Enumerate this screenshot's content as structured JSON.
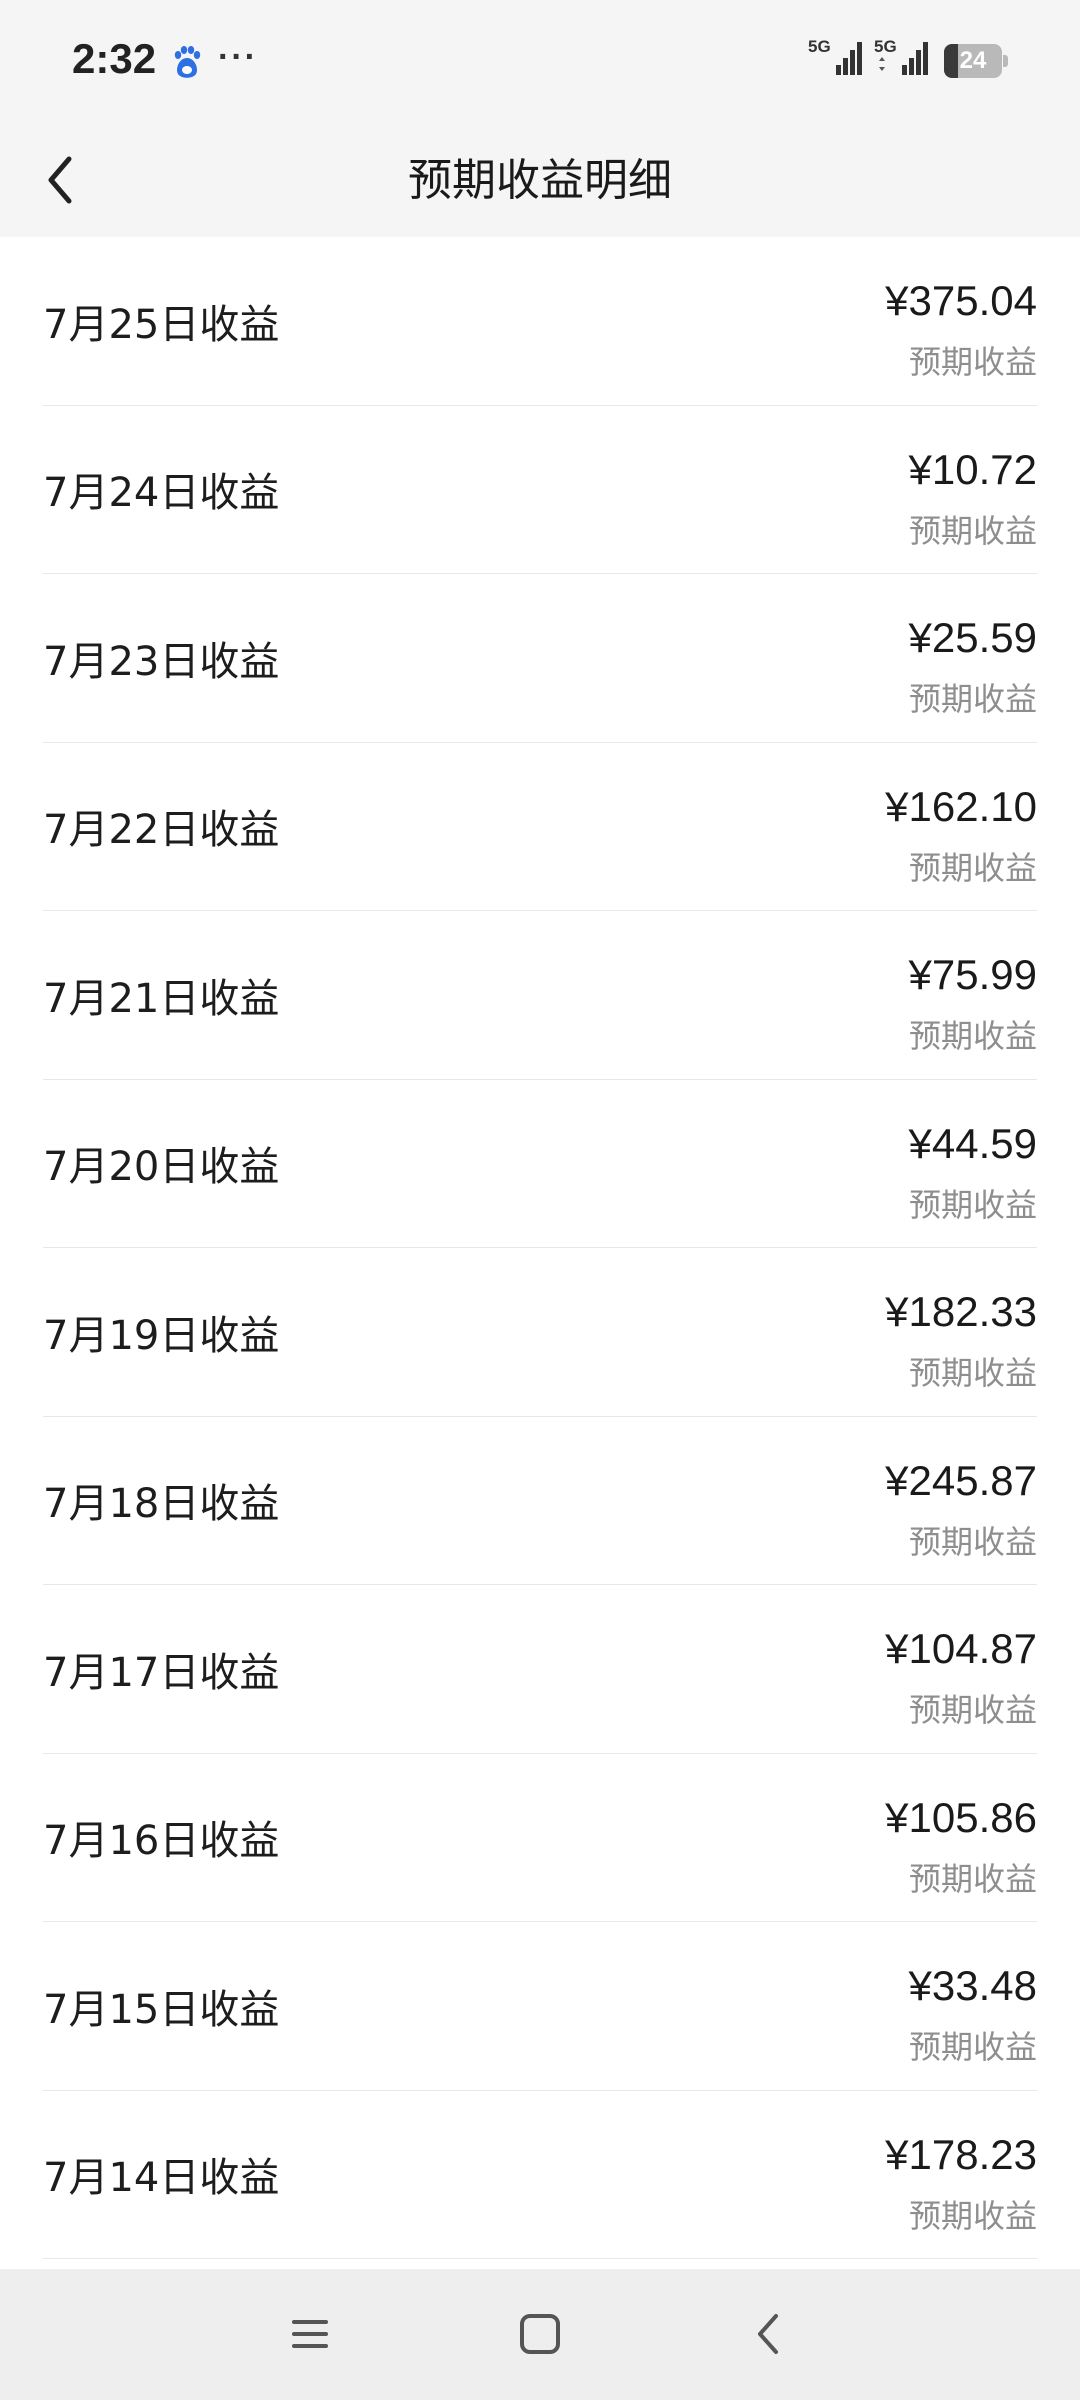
{
  "status_bar": {
    "time": "2:32",
    "icons": [
      "baidu-paw-icon",
      "more-dots-icon",
      "signal-5g-icon",
      "signal-5g-icon"
    ],
    "more": "···",
    "sim1_label": "5G",
    "sim2_label": "5G",
    "battery_text": "24",
    "battery_level": 0.24
  },
  "header": {
    "back_icon": "chevron-left-icon",
    "title": "预期收益明细"
  },
  "rows": [
    {
      "label": "7月25日收益",
      "amount": "¥375.04",
      "sub": "预期收益"
    },
    {
      "label": "7月24日收益",
      "amount": "¥10.72",
      "sub": "预期收益"
    },
    {
      "label": "7月23日收益",
      "amount": "¥25.59",
      "sub": "预期收益"
    },
    {
      "label": "7月22日收益",
      "amount": "¥162.10",
      "sub": "预期收益"
    },
    {
      "label": "7月21日收益",
      "amount": "¥75.99",
      "sub": "预期收益"
    },
    {
      "label": "7月20日收益",
      "amount": "¥44.59",
      "sub": "预期收益"
    },
    {
      "label": "7月19日收益",
      "amount": "¥182.33",
      "sub": "预期收益"
    },
    {
      "label": "7月18日收益",
      "amount": "¥245.87",
      "sub": "预期收益"
    },
    {
      "label": "7月17日收益",
      "amount": "¥104.87",
      "sub": "预期收益"
    },
    {
      "label": "7月16日收益",
      "amount": "¥105.86",
      "sub": "预期收益"
    },
    {
      "label": "7月15日收益",
      "amount": "¥33.48",
      "sub": "预期收益"
    },
    {
      "label": "7月14日收益",
      "amount": "¥178.23",
      "sub": "预期收益"
    }
  ],
  "nav_bar": {
    "icons": [
      "menu-icon",
      "home-square-icon",
      "back-triangle-icon"
    ]
  },
  "colors": {
    "background": "#f5f5f5",
    "list_background": "#ffffff",
    "divider": "#e8e8e8",
    "subtext": "#8e8e8e",
    "baidu_blue": "#2f6fe4"
  }
}
